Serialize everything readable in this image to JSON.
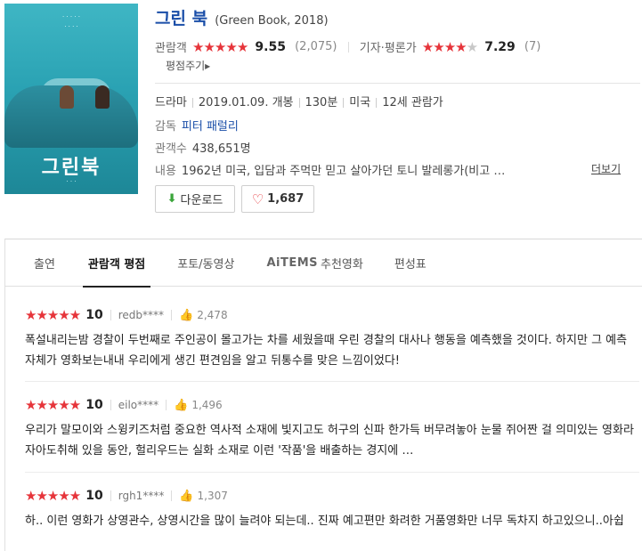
{
  "movie": {
    "title_ko": "그린 북",
    "title_en": "(Green Book, 2018)",
    "poster_title": "그린북"
  },
  "ratings": {
    "audience_label": "관람객",
    "audience_stars": "★★★★★",
    "audience_score": "9.55",
    "audience_count": "(2,075)",
    "critic_label": "기자·평론가",
    "critic_stars_full": "★★★★",
    "critic_stars_empty": "★",
    "critic_score": "7.29",
    "critic_count": "(7)",
    "rate_link": "평점주기▸"
  },
  "info": {
    "genre": "드라마",
    "release": "2019.01.09. 개봉",
    "runtime": "130분",
    "country": "미국",
    "age": "12세 관람가",
    "director_label": "감독",
    "director": "피터 패럴리",
    "audience_count_label": "관객수",
    "audience_count": "438,651명",
    "summary_label": "내용",
    "summary": "1962년 미국, 입담과 주먹만 믿고 살아가던 토니 발레롱가(비고 …",
    "more": "더보기"
  },
  "buttons": {
    "download": "다운로드",
    "likes": "1,687"
  },
  "tabs": [
    "출연",
    "관람객 평점",
    "포토/동영상",
    "추천영화",
    "편성표"
  ],
  "tab_aitems": "AiTEMS",
  "reviews": [
    {
      "stars": "★★★★★",
      "score": "10",
      "user": "redb****",
      "likes": "2,478",
      "text": "폭설내리는밤 경찰이 두번째로 주인공이 몰고가는 차를 세웠을때 우린 경찰의 대사나 행동을 예측했을 것이다. 하지만 그 예측 자체가 영화보는내내 우리에게 생긴 편견임을 알고 뒤통수를 맞은 느낌이었다!"
    },
    {
      "stars": "★★★★★",
      "score": "10",
      "user": "eilo****",
      "likes": "1,496",
      "text": "우리가 말모이와 스윙키즈처럼 중요한 역사적 소재에 빛지고도 허구의 신파 한가득 버무려놓아 눈물 쥐어짠 걸 의미있는 영화라 자아도취해 있을 동안, 헐리우드는 실화 소재로 이런 '작품'을 배출하는 경지에 …"
    },
    {
      "stars": "★★★★★",
      "score": "10",
      "user": "rgh1****",
      "likes": "1,307",
      "text": "하.. 이런 영화가 상영관수, 상영시간을 많이 늘려야 되는데.. 진짜 예고편만 화려한 거품영화만 너무 독차지 하고있으니..아쉽"
    }
  ],
  "colors": {
    "star": "#e6343a",
    "title": "#1a4ea8",
    "poster": "#2aa2b3"
  }
}
